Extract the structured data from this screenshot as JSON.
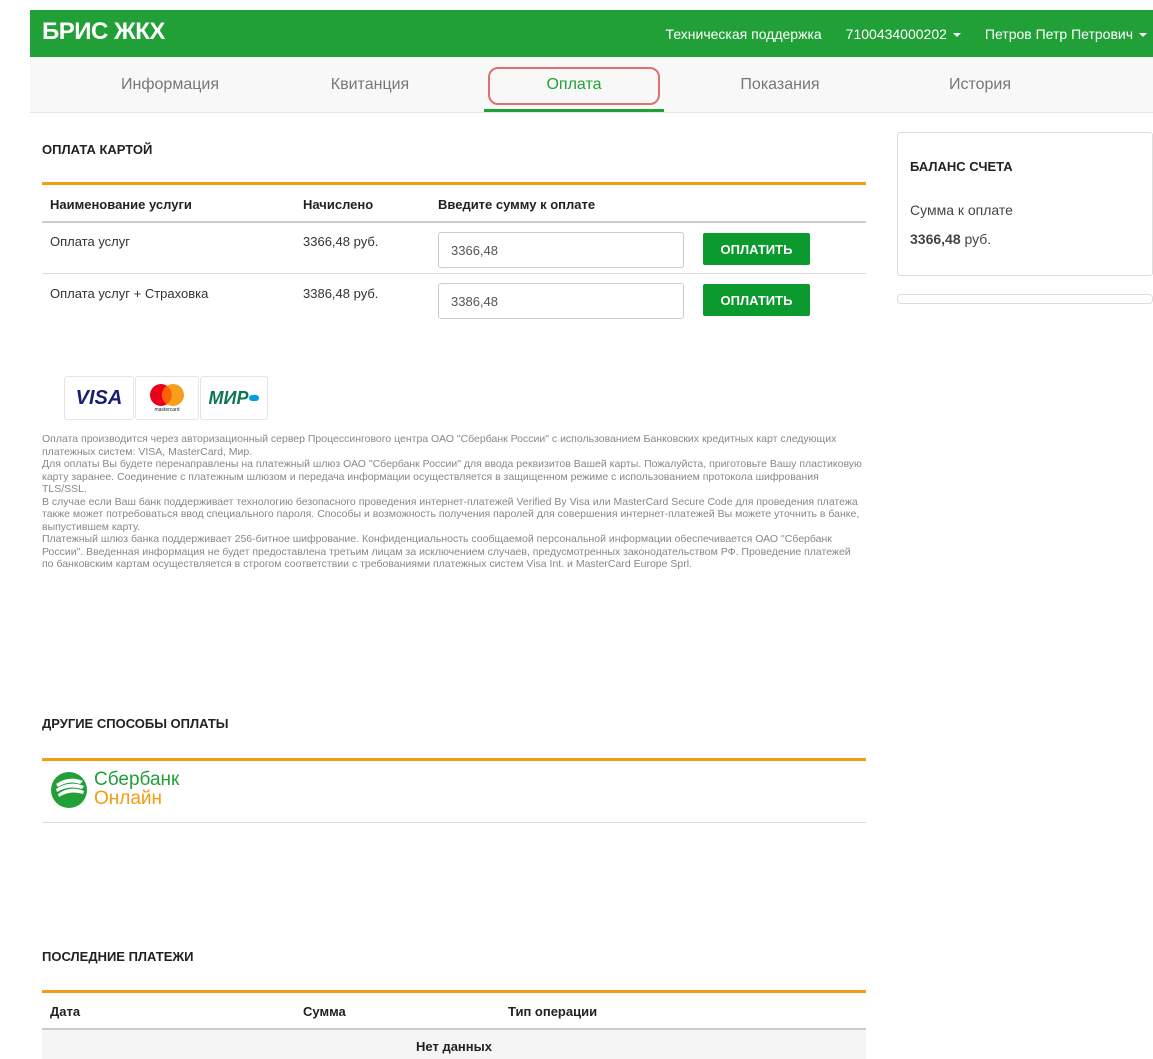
{
  "header": {
    "brand": "БРИС ЖКХ",
    "support": "Техническая поддержка",
    "account": "7100434000202",
    "user": "Петров Петр Петрович"
  },
  "tabs": [
    "Информация",
    "Квитанция",
    "Оплата",
    "Показания",
    "История"
  ],
  "card_payment": {
    "title": "ОПЛАТА КАРТОЙ",
    "headers": [
      "Наименование услуги",
      "Начислено",
      "Введите сумму к оплате"
    ],
    "rows": [
      {
        "service": "Оплата услуг",
        "charged": "3366,48 руб.",
        "amount": "3366,48",
        "button": "ОПЛАТИТЬ"
      },
      {
        "service": "Оплата услуг + Страховка",
        "charged": "3386,48 руб.",
        "amount": "3386,48",
        "button": "ОПЛАТИТЬ"
      }
    ]
  },
  "cards": {
    "visa": "VISA",
    "mastercard": "mastercard",
    "mir": "МИР"
  },
  "disclaimer": "Оплата производится через авторизационный сервер Процессингового центра ОАО \"Сбербанк России\" с использованием Банковских кредитных карт следующих платежных систем: VISA, MasterCard, Мир.\nДля оплаты Вы будете перенаправлены на платежный шлюз ОАО \"Сбербанк России\" для ввода реквизитов Вашей карты. Пожалуйста, приготовьте Вашу пластиковую карту заранее. Соединение с платежным шлюзом и передача информации осуществляется в защищенном режиме с использованием протокола шифрования TLS/SSL.\nВ случае если Ваш банк поддерживает технологию безопасного проведения интернет-платежей Verified By Visa или MasterCard Secure Code для проведения платежа также может потребоваться ввод специального пароля. Способы и возможность получения паролей для совершения интернет-платежей Вы можете уточнить в банке, выпустившем карту.\nПлатежный шлюз банка поддерживает 256-битное шифрование. Конфиденциальность сообщаемой персональной информации обеспечивается ОАО \"Сбербанк России\". Введенная информация не будет предоставлена третьим лицам за исключением случаев, предусмотренных законодательством РФ. Проведение платежей по банковским картам осуществляется в строгом соответствии с требованиями платежных систем Visa Int. и MasterCard Europe Sprl.",
  "other": {
    "title": "ДРУГИЕ СПОСОБЫ ОПЛАТЫ",
    "sber_line1": "Сбербанк",
    "sber_line2": "Онлайн"
  },
  "last_payments": {
    "title": "ПОСЛЕДНИЕ ПЛАТЕЖИ",
    "headers": [
      "Дата",
      "Сумма",
      "Тип операции"
    ],
    "empty": "Нет данных"
  },
  "balance": {
    "title": "БАЛАНС СЧЕТА",
    "label": "Сумма к оплате",
    "amount": "3366,48",
    "currency": "руб."
  },
  "colors": {
    "brand_green": "#21a038",
    "accent_orange": "#f39c12",
    "button_green": "#0a9a2e"
  }
}
